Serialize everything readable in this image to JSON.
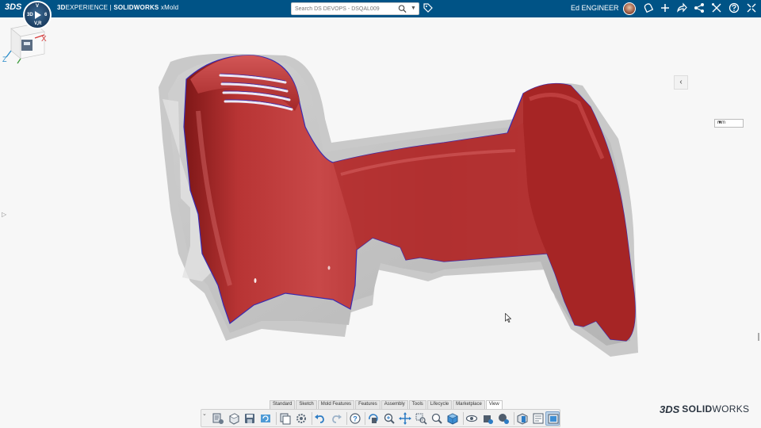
{
  "app": {
    "ds_logo": "3DS",
    "brand_bold": "3D",
    "brand_rest": "EXPERIENCE | ",
    "brand_product": "SOLIDWORKS",
    "brand_app": " xMold",
    "compass_labels": {
      "north": "V",
      "west": "3D",
      "east": "6",
      "south": "V,R"
    }
  },
  "search": {
    "placeholder": "Search DS DEVOPS - DSQAL009"
  },
  "user": {
    "name": "Ed ENGINEER"
  },
  "header_icons": [
    "tag-icon",
    "avatar",
    "notifications-icon",
    "add-icon",
    "share-icon",
    "network-icon",
    "tools-icon",
    "help-icon",
    "fullscreen-icon"
  ],
  "viewport": {
    "units": "mm",
    "model_color": "#b52b2b",
    "mold_color": "#bdbdbd"
  },
  "toolbar": {
    "tabs": [
      {
        "label": "Standard",
        "active": true
      },
      {
        "label": "Sketch",
        "active": false
      },
      {
        "label": "Mold Features",
        "active": false
      },
      {
        "label": "Features",
        "active": false
      },
      {
        "label": "Assembly",
        "active": false
      },
      {
        "label": "Tools",
        "active": false
      },
      {
        "label": "Lifecycle",
        "active": false
      },
      {
        "label": "Marketplace",
        "active": false
      },
      {
        "label": "View",
        "active": false
      }
    ],
    "tools": [
      "save-options-icon",
      "new-part-icon",
      "save-icon",
      "refresh-icon",
      "copy-icon",
      "settings-icon",
      "undo-icon",
      "redo-icon",
      "help-icon",
      "rotate-icon",
      "zoom-icon",
      "pan-icon",
      "zoom-area-icon",
      "zoom-fit-icon",
      "view-cube-icon",
      "hide-show-icon",
      "appearance-icon",
      "render-icon",
      "section-view-icon",
      "print-icon",
      "display-mode-icon"
    ]
  },
  "footer_logo": {
    "mark": "3DS",
    "bold": "SOLID",
    "rest": "WORKS"
  }
}
